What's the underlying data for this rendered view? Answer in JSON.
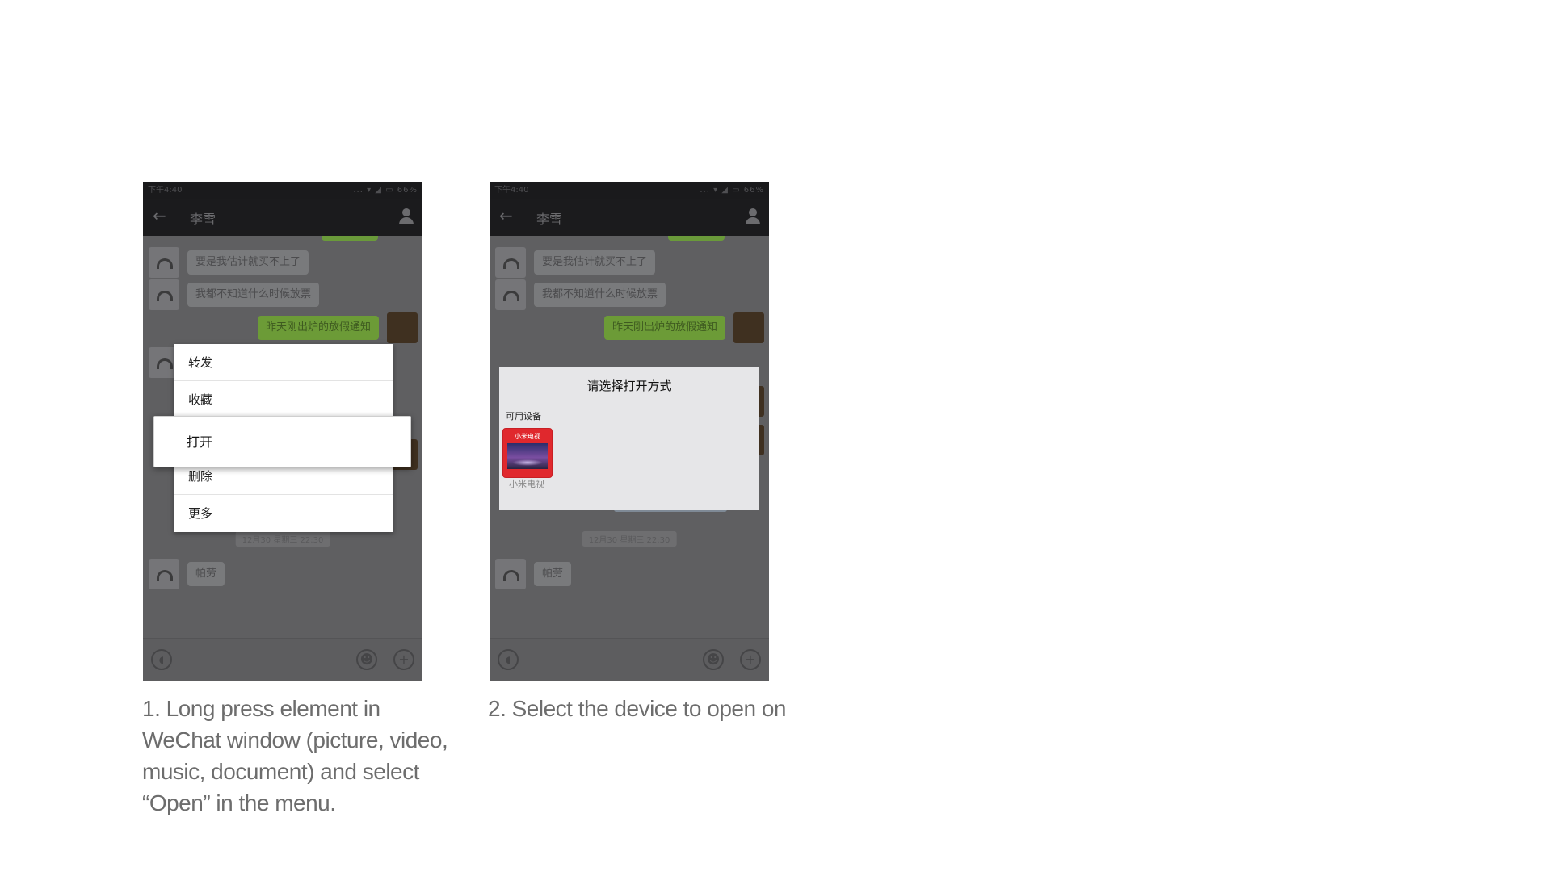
{
  "phone1": {
    "status_time": "下午4:40",
    "status_right": "... ▾ ◢ ▭ 66%",
    "chat_title": "李雪",
    "messages": [
      {
        "side": "left",
        "text": "要是我估计就买不上了"
      },
      {
        "side": "left",
        "text": "我都不知道什么时候放票"
      },
      {
        "side": "right",
        "text": "昨天刚出炉的放假通知"
      }
    ],
    "timestamp": "12月30 星期三 22:30",
    "last_message": "帕劳",
    "context_menu": {
      "items": [
        "转发",
        "收藏",
        "打开",
        "删除",
        "更多"
      ],
      "highlighted": "打开"
    }
  },
  "phone2": {
    "status_time": "下午4:40",
    "status_right": "... ▾ ◢ ▭ 66%",
    "chat_title": "李雪",
    "messages": [
      {
        "side": "left",
        "text": "要是我估计就买不上了"
      },
      {
        "side": "left",
        "text": "我都不知道什么时候放票"
      },
      {
        "side": "right",
        "text": "昨天刚出炉的放假通知"
      }
    ],
    "timestamp": "12月30 星期三 22:30",
    "last_message": "帕劳",
    "dialog": {
      "title": "请选择打开方式",
      "section": "可用设备",
      "device_tile_text": "小米电视",
      "device_label": "小米电视"
    }
  },
  "captions": {
    "step1": "1. Long press element in WeChat window (picture, video, music, document) and select “Open” in the menu.",
    "step2": "2. Select the device to open on"
  },
  "colors": {
    "menu_bg": "#ffffff",
    "dialog_bg": "#e6e6e8",
    "device_tile": "#e0282d",
    "caption_text": "#6d6d6d"
  }
}
